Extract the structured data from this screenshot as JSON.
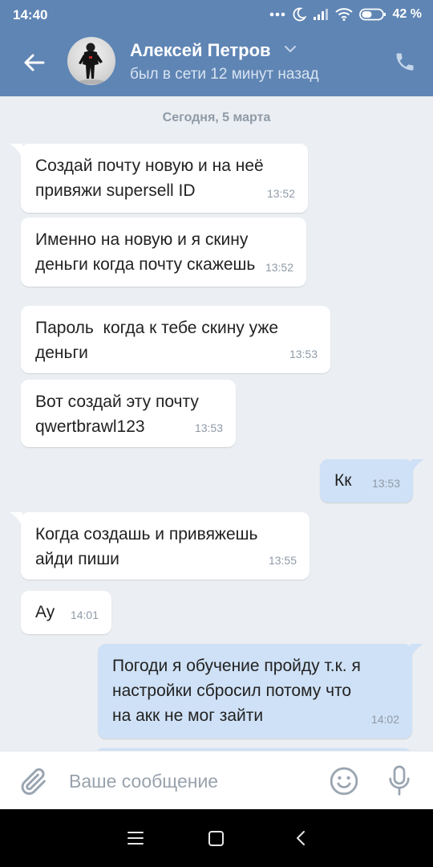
{
  "status_bar": {
    "time": "14:40",
    "battery": "42 %"
  },
  "header": {
    "contact_name": "Алексей Петров",
    "contact_status": "был в сети 12 минут назад"
  },
  "chat": {
    "date_separator": "Сегодня, 5 марта",
    "messages": [
      {
        "direction": "in",
        "text": "Создай почту новую и на неё\nпривяжи supersell ID",
        "time": "13:52"
      },
      {
        "direction": "in",
        "text": "Именно на новую и я скину\nденьги когда почту скажешь",
        "time": "13:52"
      },
      {
        "direction": "in",
        "text": "Пароль  когда к тебе скину уже\nденьги",
        "time": "13:53"
      },
      {
        "direction": "in",
        "text": "Вот создай эту почту\nqwertbrawl123",
        "time": "13:53"
      },
      {
        "direction": "out",
        "text": "Кк",
        "time": "13:53"
      },
      {
        "direction": "in",
        "text": "Когда создашь и привяжешь\nайди пиши",
        "time": "13:55"
      },
      {
        "direction": "in",
        "text": "Ау",
        "time": "14:01"
      },
      {
        "direction": "out",
        "text": "Погоди я обучение пройду т.к. я\nнастройки сбросил потому что\nна акк не мог зайти",
        "time": "14:02"
      }
    ]
  },
  "input": {
    "placeholder": "Ваше сообщение",
    "value": ""
  },
  "icons": {
    "back": "arrow-left-icon",
    "dropdown": "chevron-down-icon",
    "call": "phone-icon",
    "attach": "paperclip-icon",
    "emoji": "smiley-icon",
    "mic": "microphone-icon",
    "nav_menu": "menu-icon",
    "nav_home": "square-icon",
    "nav_back": "chevron-left-icon"
  },
  "colors": {
    "header": "#5f85b4",
    "chat_background": "#ebeef2",
    "incoming_bubble": "#ffffff",
    "outgoing_bubble": "#cfe1f6"
  }
}
